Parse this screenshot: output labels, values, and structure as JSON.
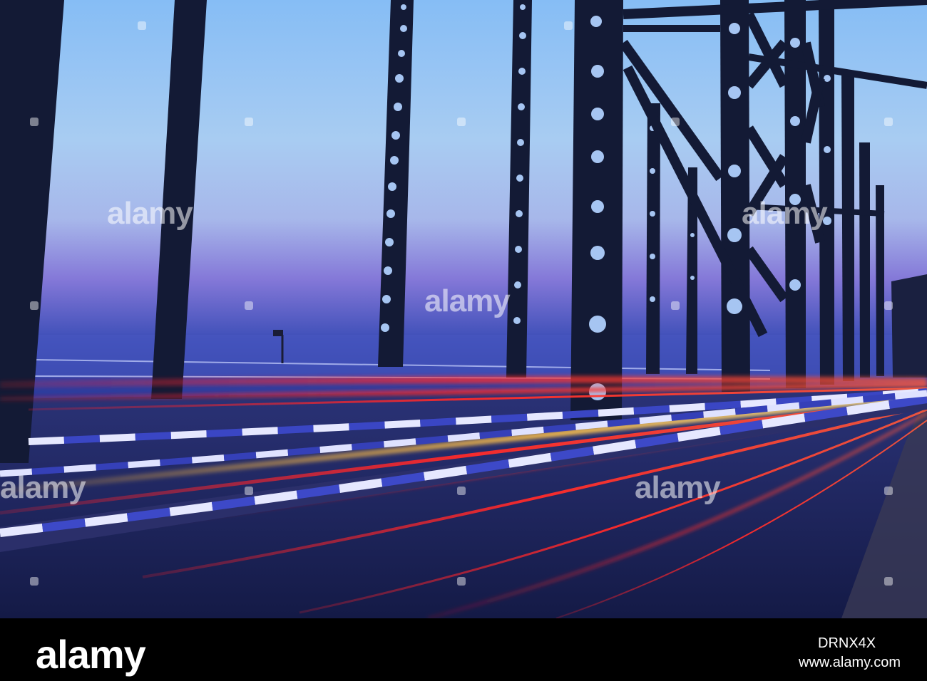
{
  "watermark": {
    "text": "alamy"
  },
  "footer": {
    "logo_text": "alamy",
    "image_id": "DRNX4X",
    "url": "www.alamy.com"
  },
  "colors": {
    "sky_top": "#7fb4f2",
    "sky_mid": "#9ec4f0",
    "horizon": "#6a6ad0",
    "steel": "#141a33",
    "road": "#2a3168",
    "light_red": "#ff2a2a",
    "light_orange": "#ffb23a",
    "footer_bg": "#000000"
  }
}
